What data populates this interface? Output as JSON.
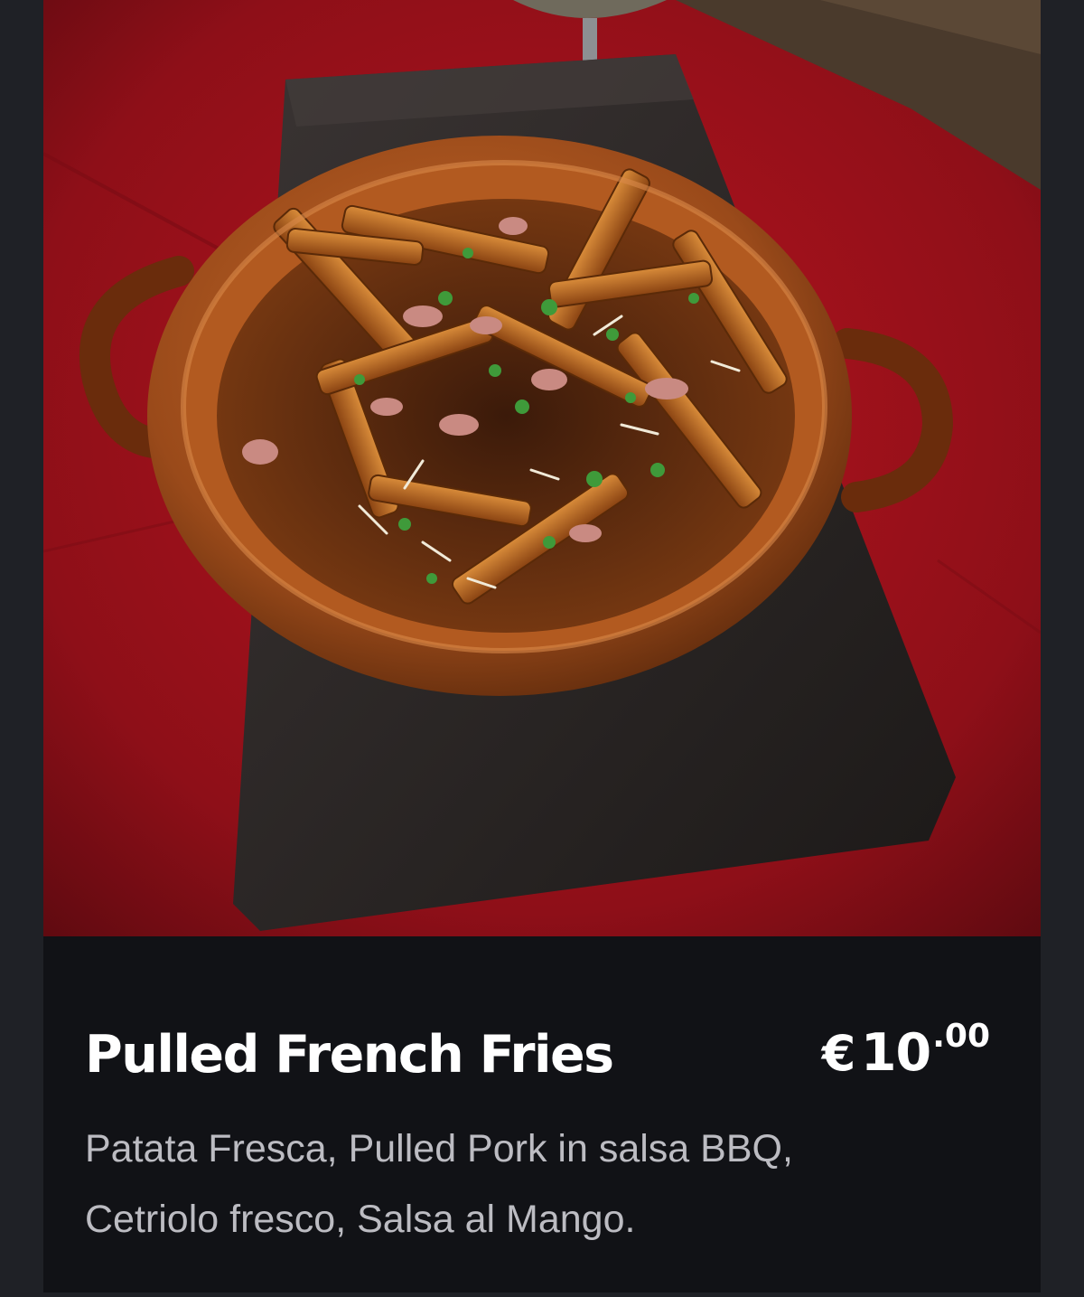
{
  "menu_item": {
    "photo_alt": "Pulled French Fries",
    "title": "Pulled French Fries",
    "price": {
      "currency": "€",
      "whole": "10",
      "decimal": ".00"
    },
    "description_lines": [
      "Patata Fresca, Pulled Pork in salsa BBQ,",
      "Cetriolo fresco, Salsa al Mango."
    ]
  },
  "colors": {
    "background": "#1f2126",
    "card": "#111216",
    "title": "#ffffff",
    "description": "#bcbcc2",
    "tablecloth": "#a0121c"
  }
}
